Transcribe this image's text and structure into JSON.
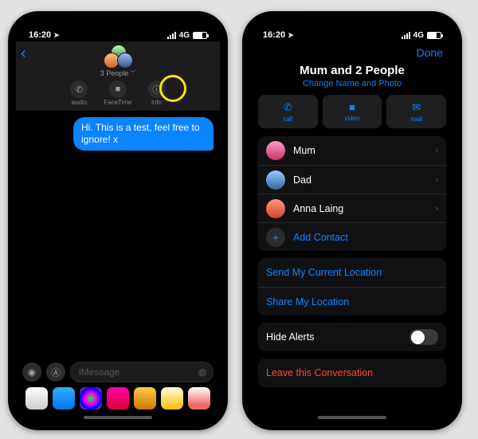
{
  "status": {
    "time": "16:20",
    "net": "4G"
  },
  "left": {
    "people_label": "3 People",
    "header_buttons": {
      "audio": "audio",
      "facetime": "FaceTime",
      "info": "info"
    },
    "message": "Hi. This is a test, feel free to ignore! x",
    "input_placeholder": "iMessage"
  },
  "right": {
    "done": "Done",
    "group_title": "Mum and 2 People",
    "group_sub": "Change Name and Photo",
    "actions": {
      "call": "call",
      "video": "video",
      "mail": "mail"
    },
    "members": {
      "m0": "Mum",
      "m1": "Dad",
      "m2": "Anna Laing"
    },
    "add_contact": "Add Contact",
    "send_location": "Send My Current Location",
    "share_location": "Share My Location",
    "hide_alerts": "Hide Alerts",
    "leave": "Leave this Conversation"
  }
}
